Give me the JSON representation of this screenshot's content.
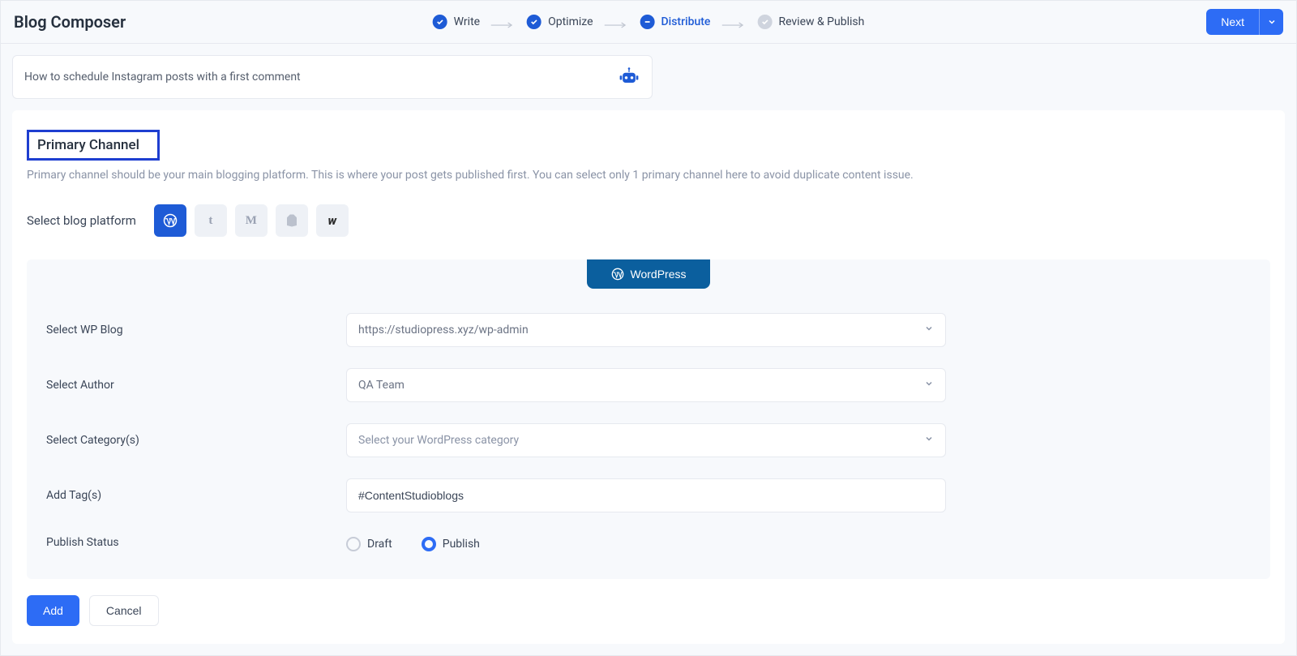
{
  "header": {
    "title": "Blog Composer",
    "steps": [
      {
        "label": "Write",
        "state": "done",
        "glyph": "check"
      },
      {
        "label": "Optimize",
        "state": "done",
        "glyph": "check"
      },
      {
        "label": "Distribute",
        "state": "current",
        "glyph": "minus"
      },
      {
        "label": "Review & Publish",
        "state": "inactive",
        "glyph": "check"
      }
    ],
    "next_label": "Next"
  },
  "post_title": "How to schedule Instagram posts with a first comment",
  "primary": {
    "heading": "Primary Channel",
    "desc": "Primary channel should be your main blogging platform. This is where your post gets published first. You can select only 1 primary channel here to avoid duplicate content issue.",
    "select_platform_label": "Select blog platform",
    "platforms": [
      {
        "id": "wordpress",
        "active": true
      },
      {
        "id": "tumblr",
        "active": false
      },
      {
        "id": "medium",
        "active": false
      },
      {
        "id": "shopify",
        "active": false
      },
      {
        "id": "webflow",
        "active": false
      }
    ]
  },
  "form": {
    "tab_label": "WordPress",
    "rows": {
      "wp_blog": {
        "label": "Select WP Blog",
        "value": "https://studiopress.xyz/wp-admin"
      },
      "author": {
        "label": "Select Author",
        "value": "QA Team"
      },
      "category": {
        "label": "Select Category(s)",
        "placeholder": "Select your WordPress category"
      },
      "tags": {
        "label": "Add Tag(s)",
        "value": "#ContentStudioblogs"
      },
      "status": {
        "label": "Publish Status",
        "draft_label": "Draft",
        "publish_label": "Publish",
        "selected": "publish"
      }
    }
  },
  "actions": {
    "add_label": "Add",
    "cancel_label": "Cancel"
  }
}
